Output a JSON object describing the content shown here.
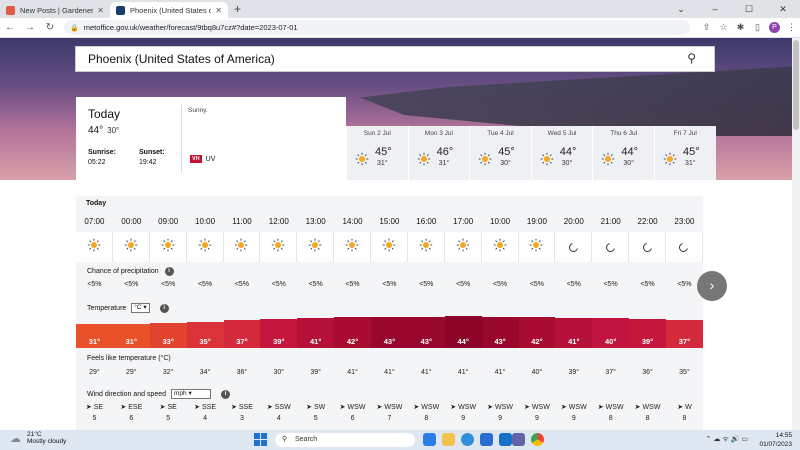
{
  "browser": {
    "tabs": [
      {
        "title": "New Posts | Gardeners Corner - T",
        "active": false
      },
      {
        "title": "Phoenix (United States of Americ",
        "active": true
      }
    ],
    "new_tab": "+",
    "url": "metoffice.gov.uk/weather/forecast/9tbq8u7cz#?date=2023-07-01",
    "profile_initial": "P"
  },
  "search": {
    "value": "Phoenix (United States of America)"
  },
  "today": {
    "title": "Today",
    "high": "44°",
    "low": "30°",
    "sunrise_label": "Sunrise:",
    "sunrise": "05:22",
    "sunset_label": "Sunset:",
    "sunset": "19:42",
    "summary": "Sunny.",
    "uv_badge": "VH",
    "uv_label": "UV"
  },
  "days": [
    {
      "name": "Sun 2 Jul",
      "high": "45°",
      "low": "31°"
    },
    {
      "name": "Mon 3 Jul",
      "high": "46°",
      "low": "31°"
    },
    {
      "name": "Tue 4 Jul",
      "high": "45°",
      "low": "30°"
    },
    {
      "name": "Wed 5 Jul",
      "high": "44°",
      "low": "30°"
    },
    {
      "name": "Thu 6 Jul",
      "high": "44°",
      "low": "30°"
    },
    {
      "name": "Fri 7 Jul",
      "high": "45°",
      "low": "31°"
    }
  ],
  "hourly": {
    "section_title": "Today",
    "hours": [
      "07:00",
      "00:00",
      "09:00",
      "10:00",
      "11:00",
      "12:00",
      "13:00",
      "14:00",
      "15:00",
      "16:00",
      "17:00",
      "10:00",
      "19:00",
      "20:00",
      "21:00",
      "22:00",
      "23:00"
    ],
    "icons": [
      "sun",
      "sun",
      "sun",
      "sun",
      "sun",
      "sun",
      "sun",
      "sun",
      "sun",
      "sun",
      "sun",
      "sun",
      "sun",
      "moon",
      "moon",
      "moon",
      "moon"
    ],
    "precip_label": "Chance of precipitation",
    "precip": [
      "<5%",
      "<5%",
      "<5%",
      "<5%",
      "<5%",
      "<5%",
      "<5%",
      "<5%",
      "<5%",
      "<5%",
      "<5%",
      "<5%",
      "<5%",
      "<5%",
      "<5%",
      "<5%",
      "<5%"
    ],
    "temp_label": "Temperature",
    "temp_unit": "°C",
    "temps": [
      "31°",
      "31°",
      "33°",
      "35°",
      "37°",
      "39°",
      "41°",
      "42°",
      "43°",
      "43°",
      "44°",
      "43°",
      "42°",
      "41°",
      "40°",
      "39°",
      "37°"
    ],
    "temp_values": [
      31,
      31,
      33,
      35,
      37,
      39,
      41,
      42,
      43,
      43,
      44,
      43,
      42,
      41,
      40,
      39,
      37
    ],
    "temp_colors": [
      "#e8512a",
      "#e8512a",
      "#e2432f",
      "#d93238",
      "#d32a3c",
      "#c5173e",
      "#b51037",
      "#a80c31",
      "#98082c",
      "#98082c",
      "#8c0528",
      "#98082c",
      "#a80c31",
      "#b51037",
      "#c01540",
      "#c5173e",
      "#d32a3c"
    ],
    "feels_label": "Feels like temperature (°C)",
    "feels": [
      "29°",
      "29°",
      "32°",
      "34°",
      "36°",
      "30°",
      "39°",
      "41°",
      "41°",
      "41°",
      "41°",
      "41°",
      "40°",
      "39°",
      "37°",
      "36°",
      "35°"
    ],
    "wind_label": "Wind direction and speed",
    "wind_unit": "mph",
    "wind_dir": [
      "SE",
      "ESE",
      "SE",
      "SSE",
      "SSE",
      "SSW",
      "SW",
      "WSW",
      "WSW",
      "WSW",
      "WSW",
      "WSW",
      "WSW",
      "WSW",
      "WSW",
      "WSW",
      "W"
    ],
    "wind_speed": [
      "5",
      "6",
      "5",
      "4",
      "3",
      "4",
      "5",
      "6",
      "7",
      "8",
      "9",
      "9",
      "9",
      "9",
      "8",
      "8",
      "8"
    ]
  },
  "next_button": "›",
  "taskbar": {
    "weather_temp": "21°C",
    "weather_desc": "Mostly cloudy",
    "search_placeholder": "Search",
    "time": "14:55",
    "date": "01/07/2023"
  }
}
